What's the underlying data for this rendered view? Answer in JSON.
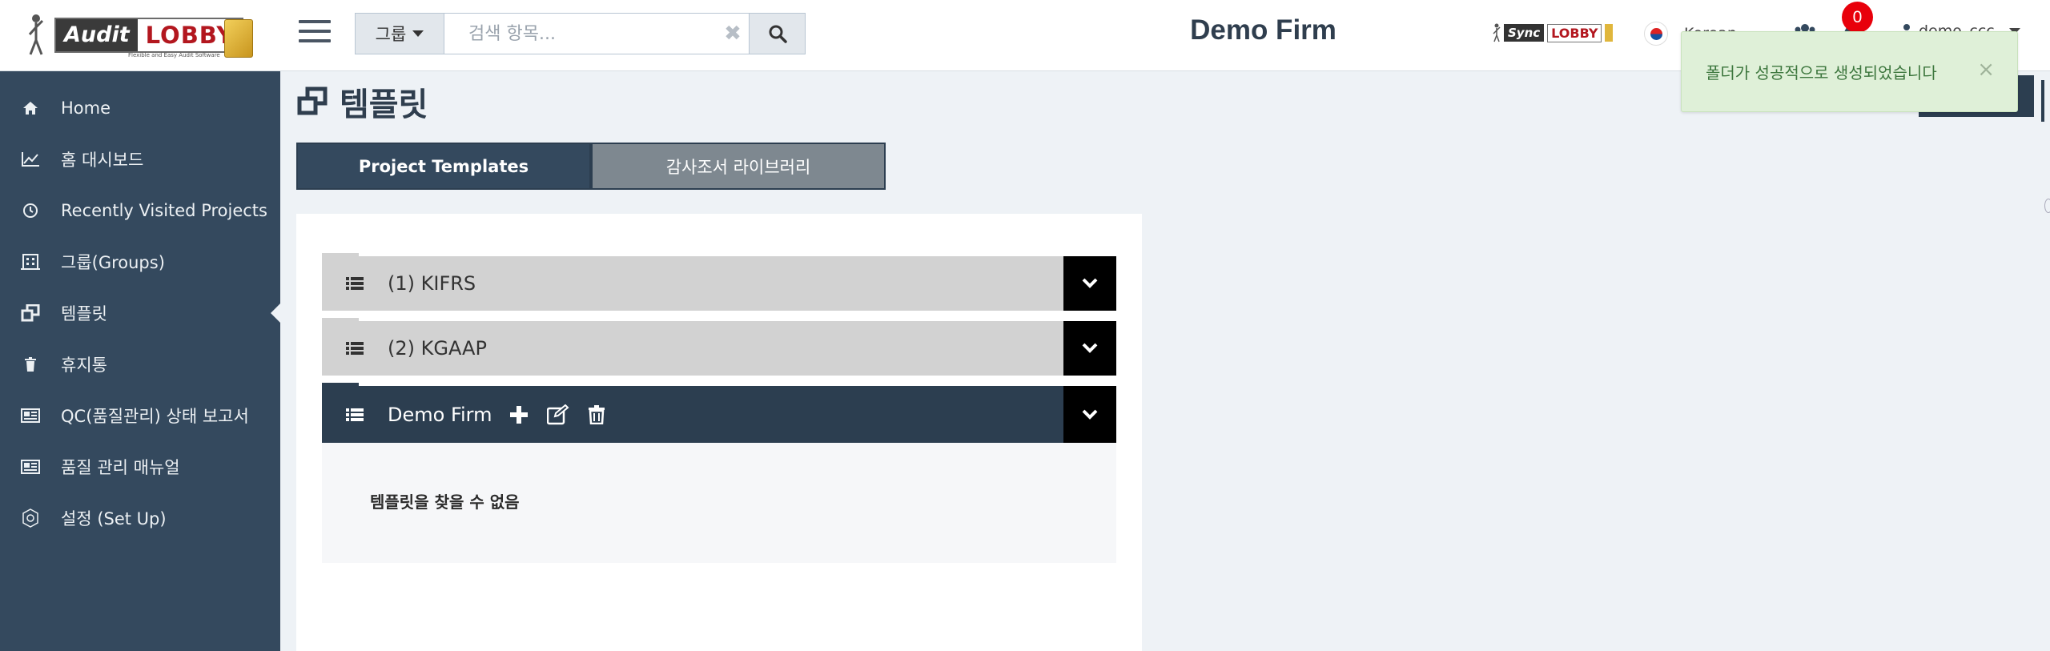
{
  "app": {
    "logo_text_left": "Audit",
    "logo_text_right": "LOBBY",
    "logo_tagline": "Flexible and Easy Audit Software",
    "firm_name": "Demo Firm"
  },
  "header": {
    "group_select_label": "그룹",
    "search_placeholder": "검색 항목...",
    "sync_logo_left": "Sync",
    "sync_logo_right": "LOBBY",
    "language": "Korean",
    "notification_count": "0",
    "user_name": "demo_ccc"
  },
  "sidebar": {
    "items": [
      {
        "label": "Home",
        "icon": "home-icon"
      },
      {
        "label": "홈 대시보드",
        "icon": "chart-line-icon"
      },
      {
        "label": "Recently Visited Projects",
        "icon": "clock-icon"
      },
      {
        "label": "그룹(Groups)",
        "icon": "building-icon"
      },
      {
        "label": "템플릿",
        "icon": "clone-icon",
        "active": true
      },
      {
        "label": "휴지통",
        "icon": "trash-icon"
      },
      {
        "label": "QC(품질관리) 상태 보고서",
        "icon": "newspaper-icon"
      },
      {
        "label": "품질 관리 매뉴얼",
        "icon": "newspaper-icon"
      },
      {
        "label": "설정 (Set Up)",
        "icon": "settings-icon"
      }
    ]
  },
  "main": {
    "page_title": "템플릿",
    "tabs": [
      {
        "label": "Project Templates",
        "active": true
      },
      {
        "label": "감사조서 라이브러리",
        "active": false
      }
    ],
    "folders": [
      {
        "label": "(1) KIFRS",
        "expanded": false
      },
      {
        "label": "(2) KGAAP",
        "expanded": false
      },
      {
        "label": "Demo Firm",
        "expanded": true
      }
    ],
    "empty_message": "템플릿을 찾을 수 없음"
  },
  "toast": {
    "message": "폴더가 성공적으로 생성되었습니다",
    "close_symbol": "×"
  },
  "colors": {
    "sidebar_bg": "#34495e",
    "header_dark": "#2c3e50",
    "toast_bg": "#dff0d8",
    "badge_red": "#e8000b"
  }
}
